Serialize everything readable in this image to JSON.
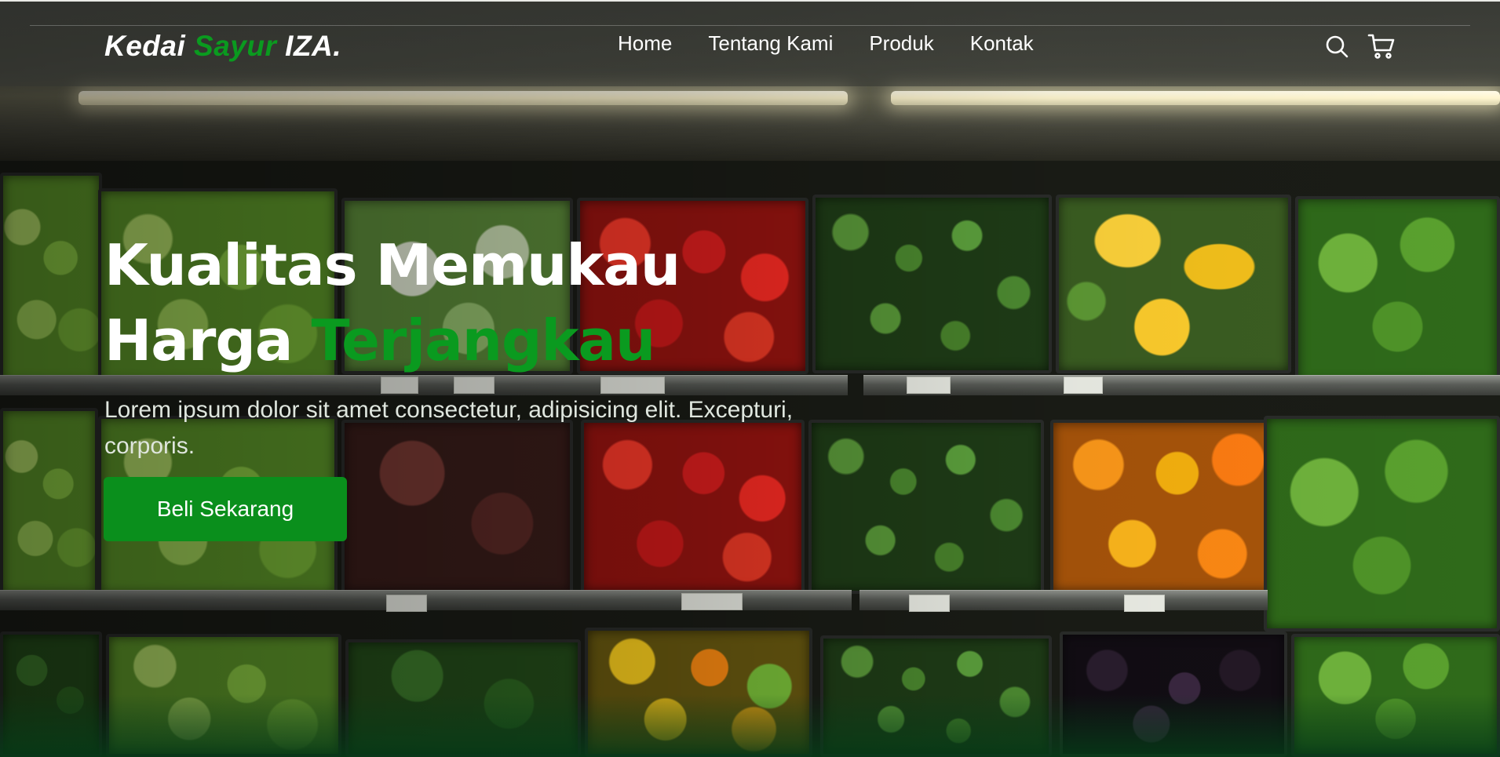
{
  "navbar": {
    "logo": {
      "part1": "Kedai ",
      "part2": "Sayur",
      "part3": " IZA."
    },
    "links": [
      {
        "label": "Home"
      },
      {
        "label": "Tentang Kami"
      },
      {
        "label": "Produk"
      },
      {
        "label": "Kontak"
      }
    ],
    "icons": [
      "search-icon",
      "cart-icon"
    ]
  },
  "hero": {
    "title_line1": "Kualitas Memukau",
    "title_line2_part1": "Harga ",
    "title_line2_part2": "Terjangkau",
    "subtitle": "Lorem ipsum dolor sit amet consectetur, adipisicing elit. Excepturi, corporis.",
    "cta_label": "Beli Sekarang"
  },
  "colors": {
    "accent_green": "#0a9a1f",
    "button_green": "#0a8f1c",
    "text_white": "#ffffff"
  }
}
